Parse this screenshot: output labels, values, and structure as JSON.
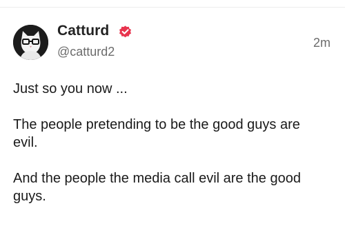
{
  "post": {
    "author": {
      "display_name": "Catturd",
      "handle": "@catturd2",
      "avatar_icon": "cat-with-glasses-avatar",
      "verified_icon": "verified-badge-icon",
      "verified_color": "#e8344e"
    },
    "timestamp": "2m",
    "paragraphs": [
      "Just so you now ...",
      "The people pretending to be the good guys are evil.",
      "And the people the media call evil are the good guys."
    ]
  }
}
